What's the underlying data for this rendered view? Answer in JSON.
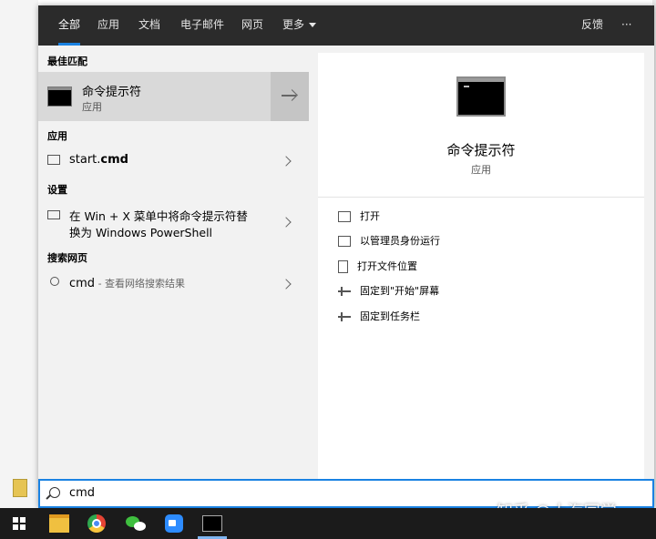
{
  "tabs": [
    "全部",
    "应用",
    "文档",
    "电子邮件",
    "网页",
    "更多"
  ],
  "feedback": "反馈",
  "more_dots": "···",
  "left": {
    "best_match_heading": "最佳匹配",
    "best_match": {
      "title": "命令提示符",
      "subtitle": "应用"
    },
    "apps_heading": "应用",
    "app_item": {
      "prefix": "start.",
      "bold": "cmd"
    },
    "settings_heading": "设置",
    "settings_item": {
      "line1": "在 Win + X 菜单中将命令提示符替",
      "line2": "换为 Windows PowerShell"
    },
    "web_heading": "搜索网页",
    "web_item": {
      "query": "cmd",
      "hint": " - 查看网络搜索结果"
    }
  },
  "right": {
    "title": "命令提示符",
    "subtitle": "应用",
    "actions": [
      "打开",
      "以管理员身份运行",
      "打开文件位置",
      "固定到\"开始\"屏幕",
      "固定到任务栏"
    ]
  },
  "search": {
    "value": "cmd"
  },
  "watermark": "知乎 @大海同学",
  "colors": {
    "accent": "#1a82e2",
    "topbar": "#2b2b2b",
    "taskbar": "#1b1b1b"
  }
}
